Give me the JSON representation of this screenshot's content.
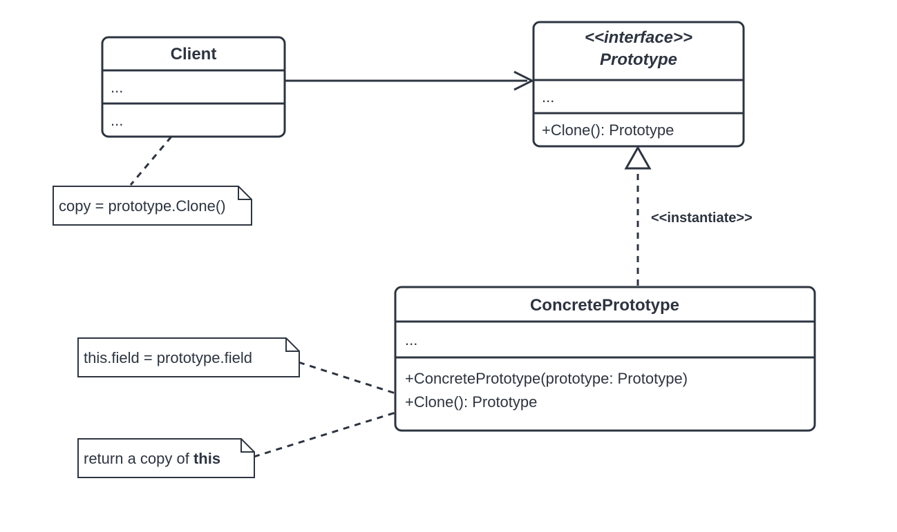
{
  "pattern": "Prototype",
  "client": {
    "name": "Client",
    "attributes": "...",
    "operations": "..."
  },
  "prototype": {
    "stereotype": "<<interface>>",
    "name": "Prototype",
    "attributes": "...",
    "operations": "+Clone(): Prototype"
  },
  "concrete": {
    "name": "ConcretePrototype",
    "attributes": "...",
    "op1": "+ConcretePrototype(prototype: Prototype)",
    "op2": "+Clone(): Prototype"
  },
  "notes": {
    "clone_call": "copy = prototype.Clone()",
    "field_copy": "this.field = prototype.field",
    "return_prefix": "return a copy of ",
    "return_bold": "this"
  },
  "labels": {
    "instantiate": "<<instantiate>>"
  },
  "colors": {
    "line": "#2d3440",
    "bg": "#ffffff"
  }
}
